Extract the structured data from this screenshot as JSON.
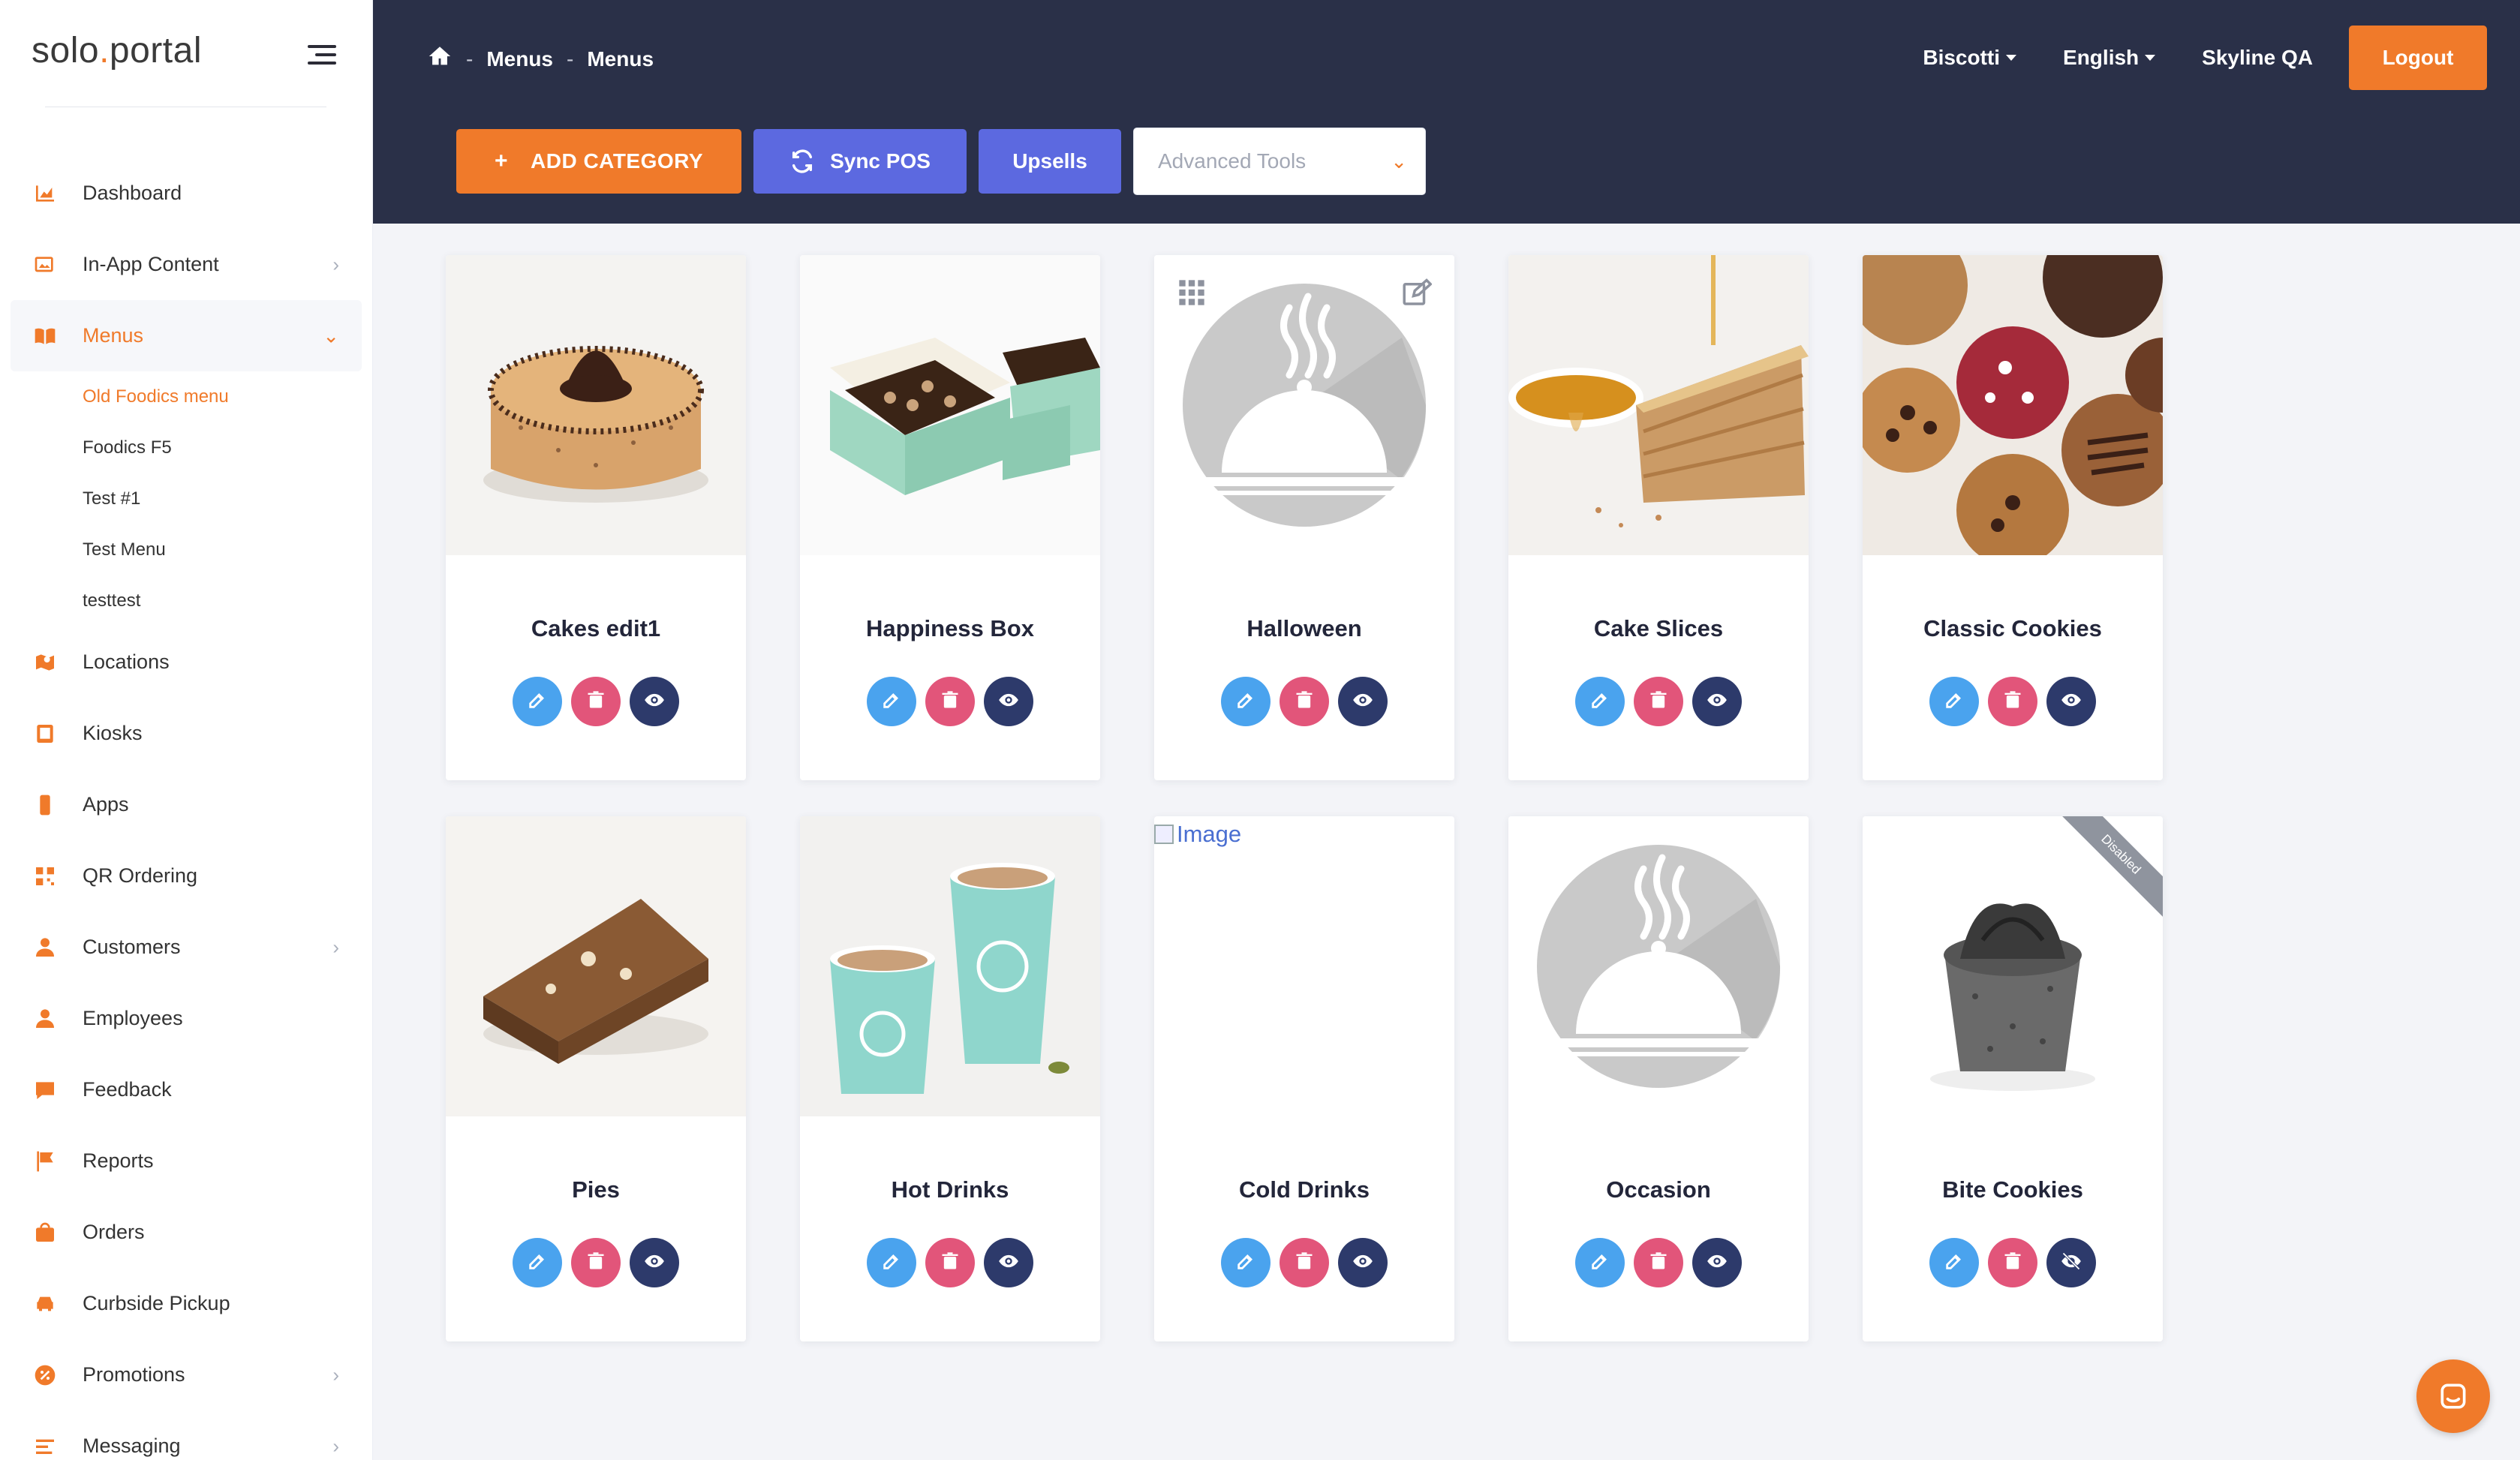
{
  "brand": {
    "part1": "solo",
    "part2": "portal"
  },
  "breadcrumb": {
    "sep": "-",
    "items": [
      "Menus",
      "Menus"
    ]
  },
  "topbar": {
    "brand_select": "Biscotti",
    "language_select": "English",
    "user_name": "Skyline QA",
    "logout_label": "Logout"
  },
  "toolbar": {
    "add_category_label": "ADD CATEGORY",
    "add_category_prefix": "+",
    "sync_pos_label": "Sync POS",
    "upsells_label": "Upsells",
    "advanced_tools_placeholder": "Advanced Tools"
  },
  "sidebar": {
    "items": [
      {
        "label": "Dashboard",
        "icon": "chart-icon"
      },
      {
        "label": "In-App Content",
        "icon": "images-icon",
        "chevron": "›"
      },
      {
        "label": "Menus",
        "icon": "book-icon",
        "chevron": "⌄",
        "active": true
      },
      {
        "label": "Locations",
        "icon": "map-icon"
      },
      {
        "label": "Kiosks",
        "icon": "tablet-icon"
      },
      {
        "label": "Apps",
        "icon": "phone-icon"
      },
      {
        "label": "QR Ordering",
        "icon": "qr-icon"
      },
      {
        "label": "Customers",
        "icon": "user-icon",
        "chevron": "›"
      },
      {
        "label": "Employees",
        "icon": "user-icon"
      },
      {
        "label": "Feedback",
        "icon": "comment-icon"
      },
      {
        "label": "Reports",
        "icon": "flag-icon"
      },
      {
        "label": "Orders",
        "icon": "bag-icon"
      },
      {
        "label": "Curbside Pickup",
        "icon": "car-icon"
      },
      {
        "label": "Promotions",
        "icon": "percent-icon",
        "chevron": "›"
      },
      {
        "label": "Messaging",
        "icon": "list-icon",
        "chevron": "›"
      }
    ],
    "submenu": [
      "Old Foodics menu",
      "Foodics F5",
      "Test #1",
      "Test Menu",
      "testtest"
    ]
  },
  "categories": [
    {
      "title": "Cakes edit1",
      "image": "cake"
    },
    {
      "title": "Happiness Box",
      "image": "boxes"
    },
    {
      "title": "Halloween",
      "image": "placeholder"
    },
    {
      "title": "Cake Slices",
      "image": "slice"
    },
    {
      "title": "Classic Cookies",
      "image": "cookies"
    },
    {
      "title": "Pies",
      "image": "brownie"
    },
    {
      "title": "Hot Drinks",
      "image": "cups"
    },
    {
      "title": "Cold Drinks",
      "image": "broken",
      "broken_alt": "Image"
    },
    {
      "title": "Occasion",
      "image": "placeholder"
    },
    {
      "title": "Bite Cookies",
      "image": "bite",
      "ribbon": "Disabled"
    }
  ],
  "colors": {
    "accent": "#f07a2a",
    "header": "#2a3048",
    "edit": "#4aa3ee",
    "delete": "#e2557a",
    "view": "#2d3a6b",
    "sync": "#5c69e0"
  }
}
